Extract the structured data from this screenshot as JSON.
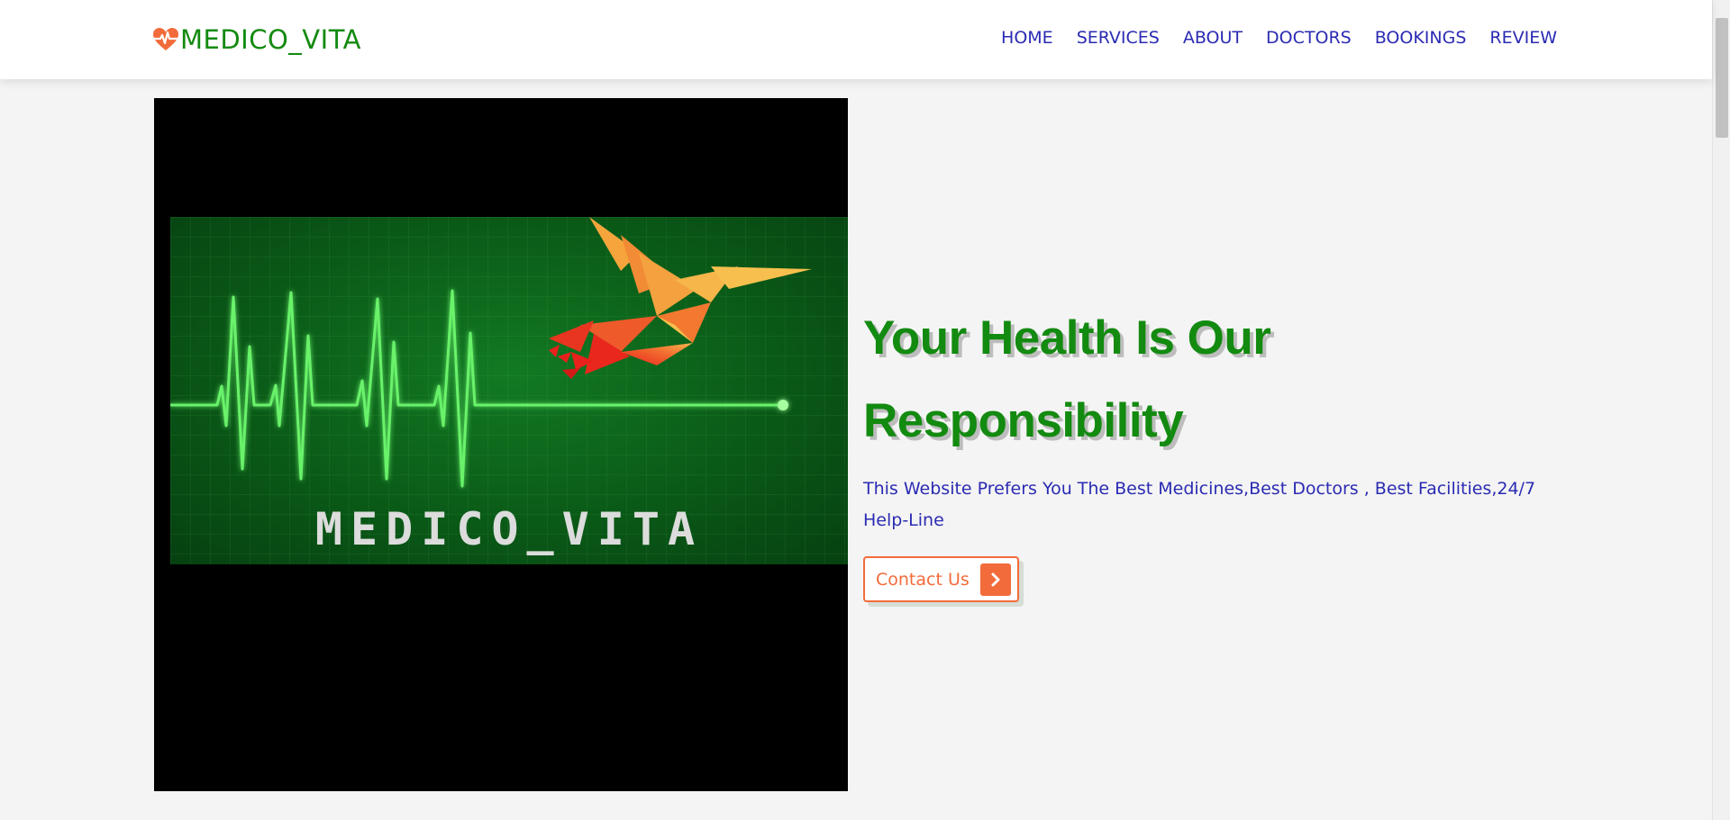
{
  "header": {
    "logo_text": "MEDICO_VITA",
    "logo_icon": "heart-pulse-icon",
    "nav": [
      "HOME",
      "SERVICES",
      "ABOUT",
      "DOCTORS",
      "BOOKINGS",
      "REVIEW"
    ]
  },
  "hero": {
    "image_text": "MEDICO_VITA",
    "title_line1": "Your Health Is Our",
    "title_line2": "Responsibility",
    "subtitle": "This Website Prefers You The Best Medicines,Best Doctors , Best Facilities,24/7 Help-Line",
    "button_label": "Contact Us",
    "button_icon": "chevron-right-icon"
  },
  "colors": {
    "brand_green": "#138a10",
    "nav_blue": "#2b2bb3",
    "accent_orange": "#f26b3a",
    "page_bg": "#f4f4f4"
  }
}
